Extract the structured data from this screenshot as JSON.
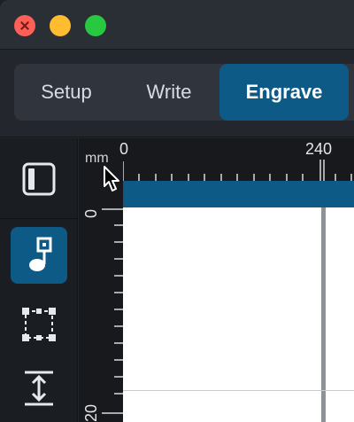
{
  "window": {
    "controls": {
      "close": "close",
      "minimize": "minimize",
      "zoom": "zoom"
    }
  },
  "mode_tabs": [
    {
      "label": "Setup",
      "active": false
    },
    {
      "label": "Write",
      "active": false
    },
    {
      "label": "Engrave",
      "active": true
    }
  ],
  "toolbar": {
    "tools": [
      {
        "icon": "panel-toggle-icon",
        "active": false
      },
      {
        "icon": "note-frame-icon",
        "active": true
      },
      {
        "icon": "frame-select-icon",
        "active": false
      },
      {
        "icon": "vertical-spacing-icon",
        "active": false
      }
    ]
  },
  "ruler": {
    "unit": "mm",
    "top_labels": [
      "0",
      "240"
    ],
    "left_labels": [
      "0",
      "20"
    ]
  },
  "colors": {
    "accent": "#0d5a86",
    "background": "#22262c",
    "page": "#ffffff"
  }
}
